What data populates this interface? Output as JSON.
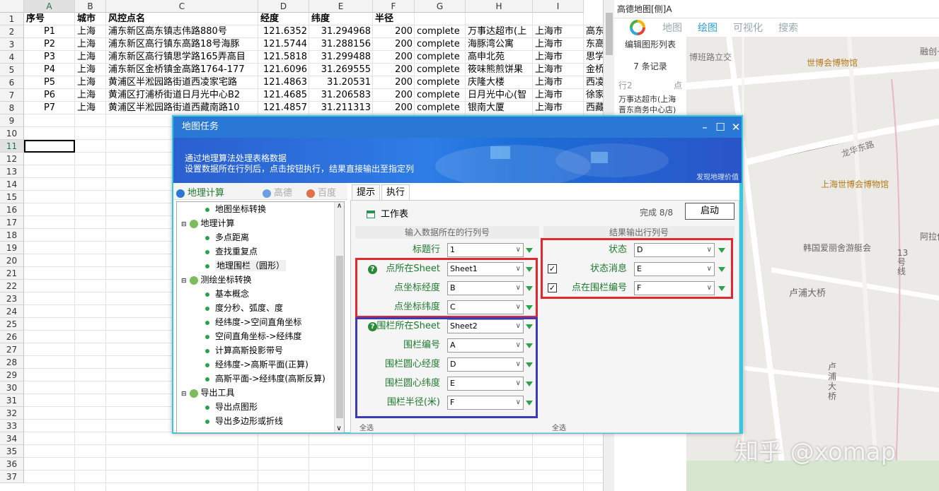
{
  "sheet": {
    "columns": [
      "A",
      "B",
      "C",
      "D",
      "E",
      "F",
      "G",
      "H",
      "I"
    ],
    "row_numbers": [
      "1",
      "2",
      "3",
      "4",
      "5",
      "6",
      "7",
      "8",
      "9",
      "10",
      "11",
      "12",
      "13",
      "14",
      "15",
      "16",
      "17",
      "18",
      "19",
      "20",
      "21",
      "22",
      "23",
      "24",
      "25",
      "26",
      "27",
      "28",
      "29",
      "30",
      "31",
      "32",
      "33",
      "34",
      "35",
      "36",
      "37"
    ],
    "headers": [
      "序号",
      "城市",
      "风控点名",
      "经度",
      "纬度",
      "半径",
      "",
      "",
      ""
    ],
    "rows": [
      [
        "P1",
        "上海",
        "浦东新区高东镇志伟路880号",
        "121.6352",
        "31.294968",
        "200",
        "complete",
        "万事达超市(上",
        "上海市",
        "高东"
      ],
      [
        "P2",
        "上海",
        "浦东新区高行镇东高路18号海豚",
        "121.5744",
        "31.288156",
        "200",
        "complete",
        "海豚湾公寓",
        "上海市",
        "东高"
      ],
      [
        "P3",
        "上海",
        "浦东新区高行镇思学路165弄高目",
        "121.5818",
        "31.299488",
        "200",
        "complete",
        "高申北苑",
        "上海市",
        "思学"
      ],
      [
        "P4",
        "上海",
        "浦东新区金桥镇金高路1764-177",
        "121.6096",
        "31.269555",
        "200",
        "complete",
        "筱味熊煎饼果",
        "上海市",
        "金桥"
      ],
      [
        "P5",
        "上海",
        "黄浦区半淞园路街道西凌家宅路",
        "121.4863",
        "31.20531",
        "200",
        "complete",
        "庆隆大楼",
        "上海市",
        "西凌"
      ],
      [
        "P6",
        "上海",
        "黄浦区打浦桥街道日月光中心B2",
        "121.4685",
        "31.206583",
        "200",
        "complete",
        "日月光中心(智",
        "上海市",
        "徐家"
      ],
      [
        "P7",
        "上海",
        "黄浦区半淞园路街道西藏南路10",
        "121.4857",
        "31.211313",
        "200",
        "complete",
        "银南大厦",
        "上海市",
        "西藏"
      ]
    ]
  },
  "map": {
    "title": "高德地图[侧]A",
    "tabs": [
      "地图",
      "绘图",
      "可视化",
      "搜索"
    ],
    "side_title": "编辑图形列表",
    "record_count": "7 条记录",
    "list_header_left": "行2",
    "list_header_right": "点",
    "list_item": "万事达超市(上海晋东商务中心店)",
    "labels": {
      "road1": "博班路立交",
      "poi1": "世博会博物馆",
      "poi2": "融创·滨",
      "road2": "龙华东路",
      "poi3": "上海世博会博物馆",
      "poi4": "韩国爱丽舍游艇会",
      "poi5": "阿拉伊",
      "metro": "13号线",
      "bridge1": "卢浦大桥",
      "bridge2": "卢浦大桥"
    },
    "watermark": "知乎 @xomap"
  },
  "dialog": {
    "title": "地图任务",
    "banner_line1": "通过地理算法处理表格数据",
    "banner_line2": "设置数据所在行列后，点击按钮执行，结果直接输出至指定列",
    "banner_tag": "发现地理价值",
    "left_tabs": [
      "地理计算",
      "高德",
      "百度"
    ],
    "tree": [
      {
        "type": "leaf",
        "label": "地图坐标转换"
      },
      {
        "type": "group",
        "label": "地理计算"
      },
      {
        "type": "leaf",
        "label": "多点距离"
      },
      {
        "type": "leaf",
        "label": "查找重复点"
      },
      {
        "type": "leaf",
        "label": "地理围栏（圆形）",
        "selected": true
      },
      {
        "type": "group",
        "label": "测绘坐标转换"
      },
      {
        "type": "leaf",
        "label": "基本概念"
      },
      {
        "type": "leaf",
        "label": "度分秒、弧度、度"
      },
      {
        "type": "leaf",
        "label": "经纬度->空间直角坐标"
      },
      {
        "type": "leaf",
        "label": "空间直角坐标->经纬度"
      },
      {
        "type": "leaf",
        "label": "计算高斯投影带号"
      },
      {
        "type": "leaf",
        "label": "经纬度->高斯平面(正算)"
      },
      {
        "type": "leaf",
        "label": "高斯平面->经纬度(高斯反算)"
      },
      {
        "type": "group",
        "label": "导出工具"
      },
      {
        "type": "leaf",
        "label": "导出点图形"
      },
      {
        "type": "leaf",
        "label": "导出多边形或折线"
      }
    ],
    "right_tabs": [
      "提示",
      "执行"
    ],
    "worksheet_label": "工作表",
    "done_text": "完成 8/8",
    "start_button": "启动",
    "input_header": "输入数据所在的行列号",
    "output_header": "结果输出行列号",
    "inputs": [
      {
        "label": "标题行",
        "value": "1"
      },
      {
        "label": "点所在Sheet",
        "value": "Sheet1"
      },
      {
        "label": "点坐标经度",
        "value": "B"
      },
      {
        "label": "点坐标纬度",
        "value": "C"
      },
      {
        "label": "围栏所在Sheet",
        "value": "Sheet2"
      },
      {
        "label": "围栏编号",
        "value": "A"
      },
      {
        "label": "围栏圆心经度",
        "value": "D"
      },
      {
        "label": "围栏圆心纬度",
        "value": "E"
      },
      {
        "label": "围栏半径(米)",
        "value": "F"
      }
    ],
    "outputs": [
      {
        "label": "状态",
        "value": "D"
      },
      {
        "label": "状态消息",
        "value": "E"
      },
      {
        "label": "点在围栏编号",
        "value": "F"
      }
    ],
    "select_all": "全选",
    "help_icon": "?",
    "check_mark": "✓",
    "dropdown_arrow": "∨",
    "minimize_glyph": "–",
    "maximize_glyph": "☐",
    "close_glyph": "✕",
    "tree_up_glyph": "∧",
    "tree_down_glyph": "∨"
  },
  "colors": {
    "accent": "#2a78d6",
    "highlight_red": "#e0282e",
    "highlight_blue": "#3b3bb8",
    "label_green": "#1e7a2e"
  }
}
